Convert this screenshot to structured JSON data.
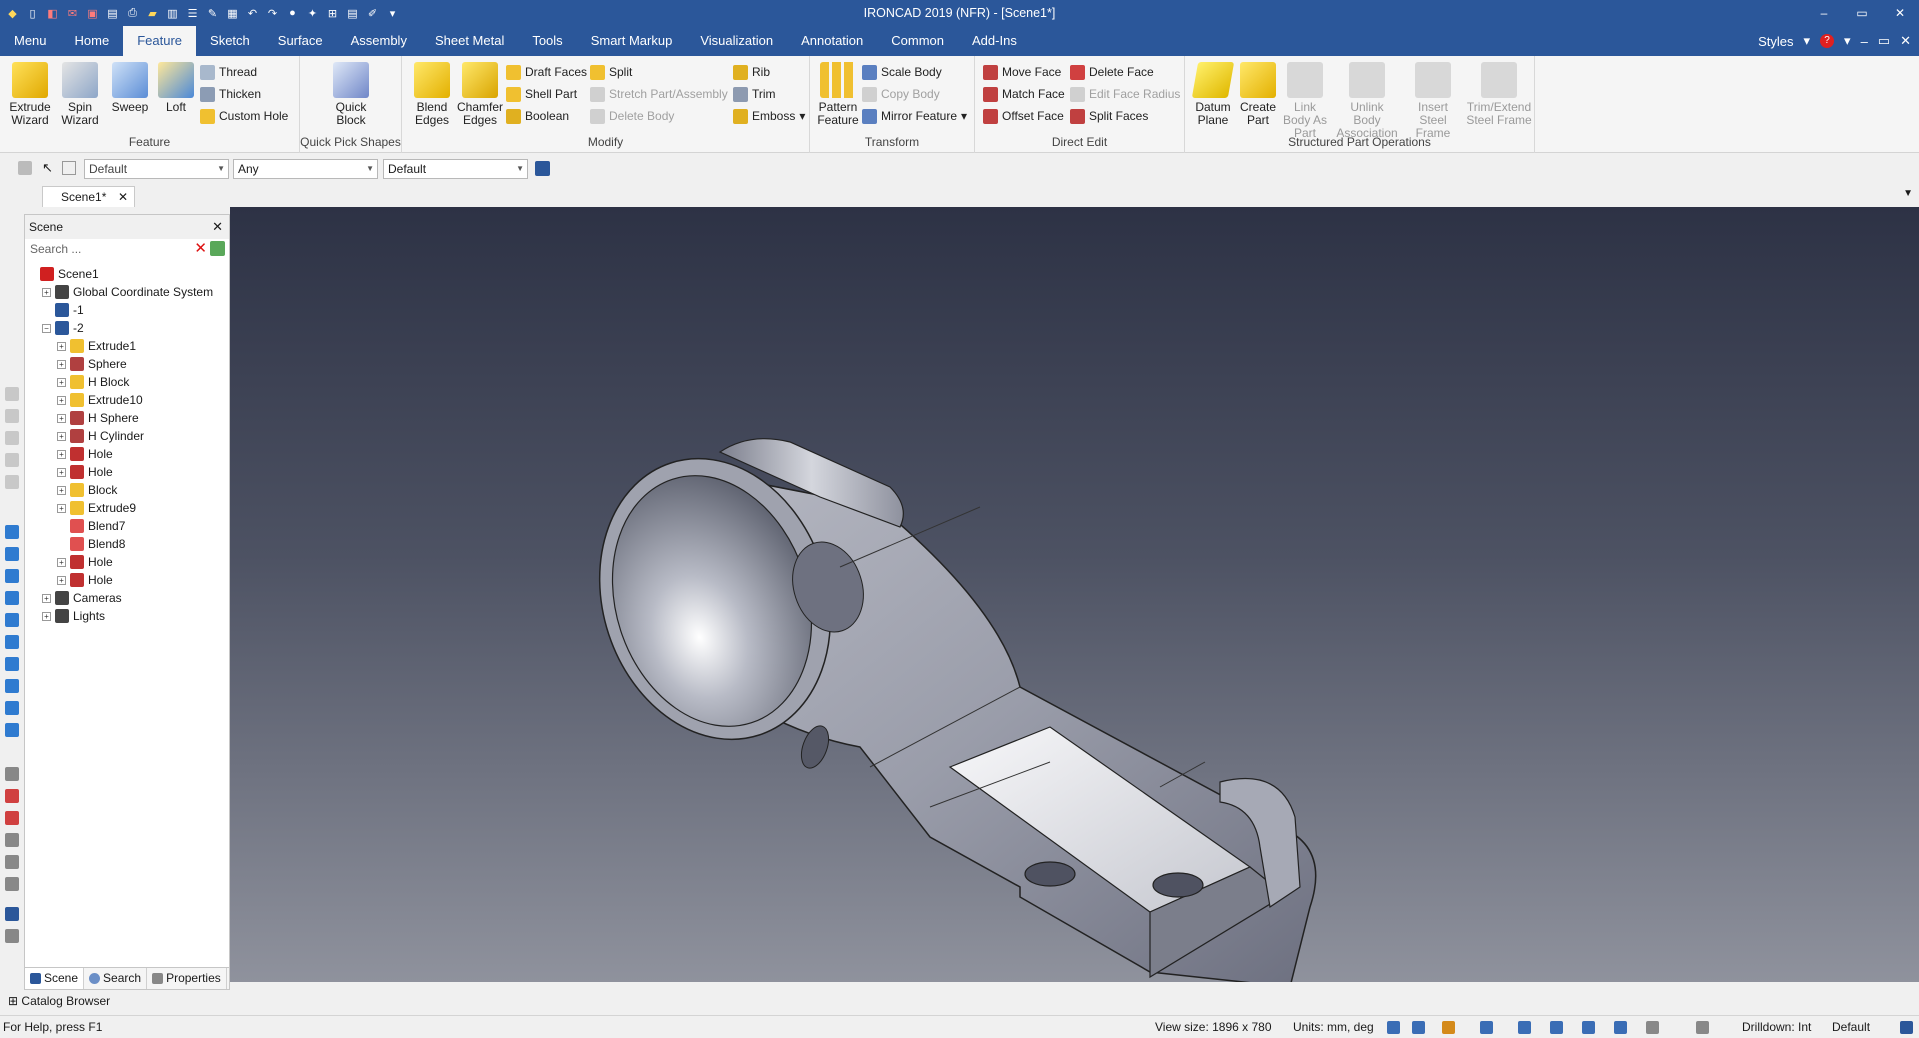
{
  "app": {
    "title": "IRONCAD 2019 (NFR) - [Scene1*]",
    "window_buttons": [
      "–",
      "▭",
      "✕"
    ]
  },
  "quick_access": [
    "app-logo-icon",
    "new-icon",
    "open-icon",
    "close-icon",
    "save-icon",
    "print-icon",
    "undo-icon",
    "redo-icon",
    "render-icon",
    "options-icon"
  ],
  "tabs": [
    "Menu",
    "Home",
    "Feature",
    "Sketch",
    "Surface",
    "Assembly",
    "Sheet Metal",
    "Tools",
    "Smart Markup",
    "Visualization",
    "Annotation",
    "Common",
    "Add-Ins"
  ],
  "active_tab": "Feature",
  "tabs_right": {
    "styles": "Styles"
  },
  "ribbon": {
    "feature_group": {
      "label": "Feature",
      "extrude": "Extrude Wizard",
      "spin": "Spin Wizard",
      "sweep": "Sweep",
      "loft": "Loft",
      "thread": "Thread",
      "thicken": "Thicken",
      "custom_hole": "Custom Hole"
    },
    "quick_pick": {
      "label": "Quick Pick Shapes",
      "quick_block": "Quick Block"
    },
    "modify": {
      "label": "Modify",
      "blend": "Blend Edges",
      "chamfer": "Chamfer Edges",
      "draft": "Draft Faces",
      "shell": "Shell Part",
      "boolean": "Boolean",
      "split": "Split",
      "stretch": "Stretch Part/Assembly",
      "delete_body": "Delete Body",
      "rib": "Rib",
      "trim": "Trim",
      "emboss": "Emboss"
    },
    "transform": {
      "label": "Transform",
      "pattern": "Pattern Feature",
      "scale": "Scale Body",
      "copy": "Copy Body",
      "mirror": "Mirror Feature"
    },
    "direct_edit": {
      "label": "Direct Edit",
      "move_face": "Move Face",
      "match_face": "Match Face",
      "offset_face": "Offset Face",
      "delete_face": "Delete Face",
      "edit_radius": "Edit Face Radius",
      "split_faces": "Split Faces"
    },
    "structured": {
      "label": "Structured Part Operations",
      "datum": "Datum Plane",
      "create_part": "Create Part",
      "link_body": "Link Body As Part",
      "unlink": "Unlink Body Association",
      "insert_steel": "Insert Steel Frame",
      "trim_steel": "Trim/Extend Steel Frame"
    }
  },
  "toolbar2": {
    "style_combo": "Default",
    "filter_combo": "Any",
    "layer_combo": "Default"
  },
  "doc_tab": {
    "label": "Scene1*",
    "close": "✕"
  },
  "scene_panel": {
    "title": "Scene",
    "close": "✕",
    "search_placeholder": "Search ...",
    "tree": [
      {
        "label": "Scene1",
        "depth": 0,
        "exp": "",
        "icon": "scene-icon"
      },
      {
        "label": "Global Coordinate System",
        "depth": 1,
        "exp": "+",
        "icon": "axes-icon"
      },
      {
        "label": "-1",
        "depth": 1,
        "exp": "",
        "icon": "assembly-icon"
      },
      {
        "label": "-2",
        "depth": 1,
        "exp": "-",
        "icon": "assembly-icon"
      },
      {
        "label": "Extrude1",
        "depth": 2,
        "exp": "+",
        "icon": "extrude-icon"
      },
      {
        "label": "Sphere",
        "depth": 2,
        "exp": "+",
        "icon": "sphere-icon"
      },
      {
        "label": "H Block",
        "depth": 2,
        "exp": "+",
        "icon": "block-icon"
      },
      {
        "label": "Extrude10",
        "depth": 2,
        "exp": "+",
        "icon": "extrude-icon"
      },
      {
        "label": "H Sphere",
        "depth": 2,
        "exp": "+",
        "icon": "sphere-icon"
      },
      {
        "label": "H Cylinder",
        "depth": 2,
        "exp": "+",
        "icon": "cylinder-icon"
      },
      {
        "label": "Hole",
        "depth": 2,
        "exp": "+",
        "icon": "hole-icon"
      },
      {
        "label": "Hole",
        "depth": 2,
        "exp": "+",
        "icon": "hole-icon"
      },
      {
        "label": "Block",
        "depth": 2,
        "exp": "+",
        "icon": "block-icon"
      },
      {
        "label": "Extrude9",
        "depth": 2,
        "exp": "+",
        "icon": "extrude-icon"
      },
      {
        "label": "Blend7",
        "depth": 2,
        "exp": "",
        "icon": "blend-icon"
      },
      {
        "label": "Blend8",
        "depth": 2,
        "exp": "",
        "icon": "blend-icon"
      },
      {
        "label": "Hole",
        "depth": 2,
        "exp": "+",
        "icon": "hole-icon"
      },
      {
        "label": "Hole",
        "depth": 2,
        "exp": "+",
        "icon": "hole-icon"
      },
      {
        "label": "Cameras",
        "depth": 1,
        "exp": "+",
        "icon": "camera-icon"
      },
      {
        "label": "Lights",
        "depth": 1,
        "exp": "+",
        "icon": "light-icon"
      }
    ],
    "bottom_tabs": [
      "Scene",
      "Search",
      "Properties"
    ]
  },
  "catalog_browser": "Catalog Browser",
  "status": {
    "help": "For Help, press F1",
    "view_size": "View size: 1896 x 780",
    "units": "Units: mm, deg",
    "drilldown": "Drilldown: Int",
    "style": "Default"
  },
  "colors": {
    "accent": "#2b579a",
    "ribbon_bg": "#f5f5f5",
    "viewport_top": "#2d3245",
    "viewport_bottom": "#8f929d",
    "part_face": "#c9cbd3"
  }
}
